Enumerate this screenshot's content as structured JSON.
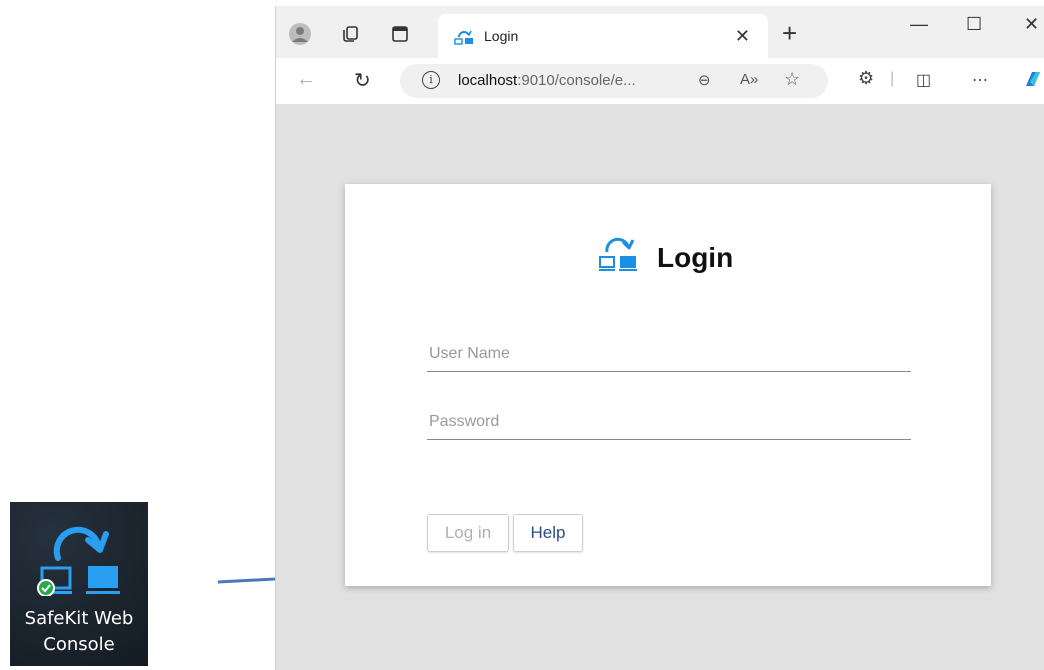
{
  "desktop_icon": {
    "label": "SafeKit Web Console"
  },
  "browser": {
    "tab": {
      "title": "Login"
    },
    "address_bar": {
      "host": "localhost",
      "rest": ":9010/console/e..."
    },
    "window_controls": {
      "minimize": "—",
      "maximize": "☐",
      "close": "✕"
    }
  },
  "login_card": {
    "title": "Login",
    "username": {
      "placeholder": "User Name",
      "value": ""
    },
    "password": {
      "placeholder": "Password",
      "value": ""
    },
    "buttons": {
      "login": "Log in",
      "help": "Help"
    }
  },
  "colors": {
    "accent": "#1a8fe3",
    "help_text": "#2a4f8c",
    "viewport_bg": "#e1e1e1"
  },
  "icons": [
    "profile-icon",
    "workspaces-icon",
    "tab-actions-icon",
    "back-icon",
    "refresh-icon",
    "info-icon",
    "zoom-icon",
    "read-aloud-icon",
    "favorite-icon",
    "extensions-icon",
    "split-screen-icon",
    "more-icon",
    "copilot-icon"
  ]
}
